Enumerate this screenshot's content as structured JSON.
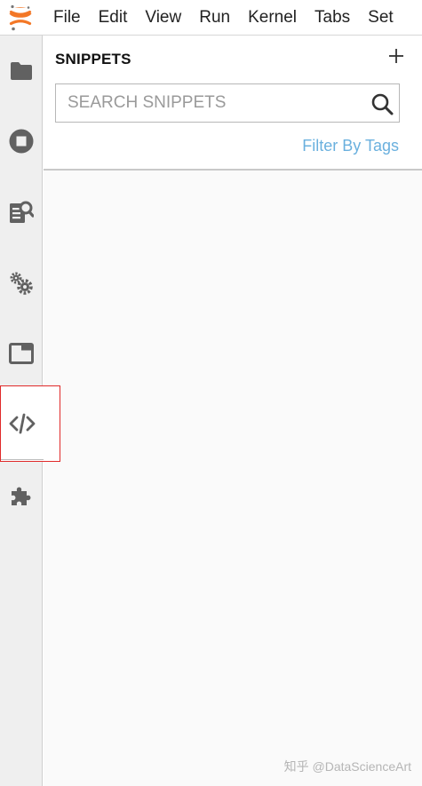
{
  "menubar": {
    "items": [
      {
        "label": "File"
      },
      {
        "label": "Edit"
      },
      {
        "label": "View"
      },
      {
        "label": "Run"
      },
      {
        "label": "Kernel"
      },
      {
        "label": "Tabs"
      },
      {
        "label": "Set"
      }
    ]
  },
  "sidebar": {
    "icons": [
      {
        "name": "folder-icon"
      },
      {
        "name": "stop-circle-icon"
      },
      {
        "name": "property-inspector-icon"
      },
      {
        "name": "gears-icon"
      },
      {
        "name": "tab-window-icon"
      },
      {
        "name": "code-snippet-icon",
        "selected": true
      },
      {
        "name": "puzzle-extension-icon"
      }
    ],
    "highlight_color": "#e02a2a"
  },
  "snippets_panel": {
    "title": "SNIPPETS",
    "add_label": "+",
    "search": {
      "placeholder": "SEARCH SNIPPETS",
      "value": ""
    },
    "filter_label": "Filter By Tags"
  },
  "watermark": "知乎 @DataScienceArt",
  "colors": {
    "accent_link": "#6ab0de",
    "logo_orange": "#f37726",
    "icon_gray": "#616161"
  }
}
